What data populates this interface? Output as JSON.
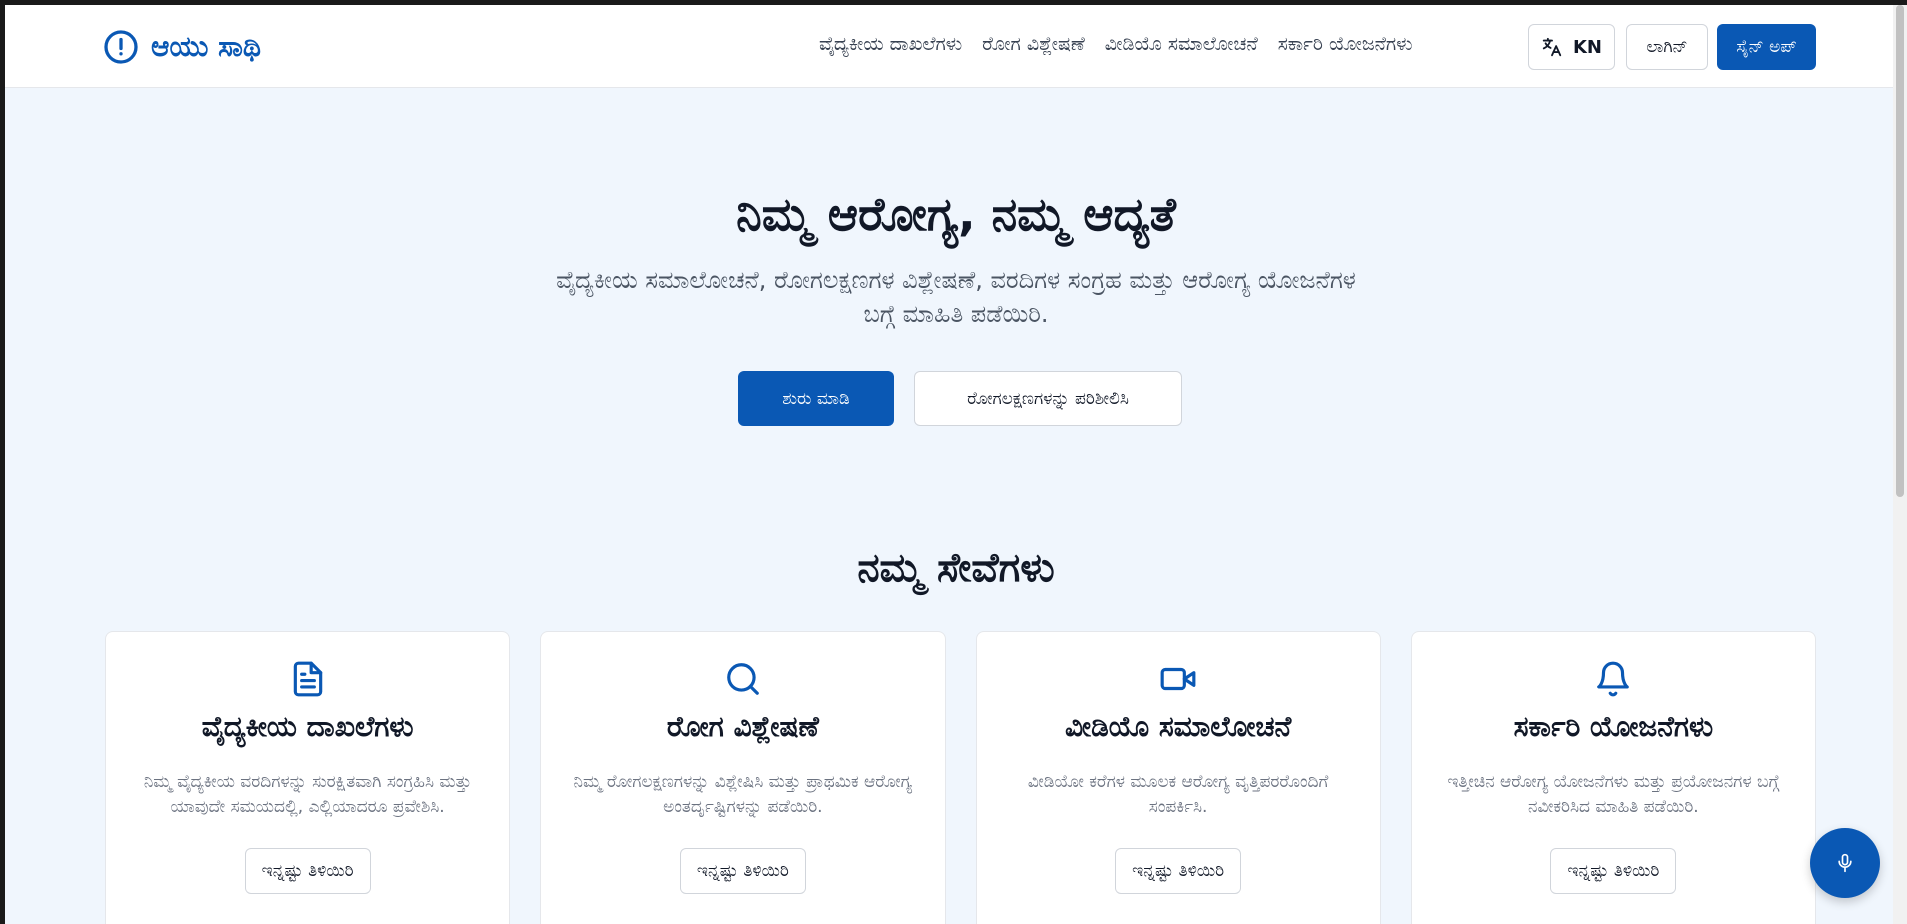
{
  "brand": {
    "name": "ಆಯು ಸಾಥಿ",
    "icon": "alert-circle-icon",
    "color": "#0a58b4"
  },
  "nav": {
    "items": [
      {
        "label": "ವೈದ್ಯಕೀಯ ದಾಖಲೆಗಳು"
      },
      {
        "label": "ರೋಗ ವಿಶ್ಲೇಷಣೆ"
      },
      {
        "label": "ವೀಡಿಯೊ ಸಮಾಲೋಚನೆ"
      },
      {
        "label": "ಸರ್ಕಾರಿ ಯೋಜನೆಗಳು"
      }
    ],
    "language_label": "KN",
    "language_icon": "translate-icon",
    "login_label": "ಲಾಗಿನ್",
    "signup_label": "ಸೈನ್ ಅಪ್"
  },
  "hero": {
    "title": "ನಿಮ್ಮ ಆರೋಗ್ಯ, ನಮ್ಮ ಆದ್ಯತೆ",
    "subtitle": "ವೈದ್ಯಕೀಯ ಸಮಾಲೋಚನೆ, ರೋಗಲಕ್ಷಣಗಳ ವಿಶ್ಲೇಷಣೆ, ವರದಿಗಳ ಸಂಗ್ರಹ ಮತ್ತು ಆರೋಗ್ಯ ಯೋಜನೆಗಳ ಬಗ್ಗೆ ಮಾಹಿತಿ ಪಡೆಯಿರಿ.",
    "primary_cta": "ಶುರು ಮಾಡಿ",
    "secondary_cta": "ರೋಗಲಕ್ಷಣಗಳನ್ನು ಪರಿಶೀಲಿಸಿ"
  },
  "services": {
    "title": "ನಮ್ಮ ಸೇವೆಗಳು",
    "cards": [
      {
        "icon": "document-icon",
        "title": "ವೈದ್ಯಕೀಯ ದಾಖಲೆಗಳು",
        "description": "ನಿಮ್ಮ ವೈದ್ಯಕೀಯ ವರದಿಗಳನ್ನು ಸುರಕ್ಷಿತವಾಗಿ ಸಂಗ್ರಹಿಸಿ ಮತ್ತು ಯಾವುದೇ ಸಮಯದಲ್ಲಿ, ಎಲ್ಲಿಯಾದರೂ ಪ್ರವೇಶಿಸಿ.",
        "button": "ಇನ್ನಷ್ಟು ತಿಳಿಯಿರಿ"
      },
      {
        "icon": "search-icon",
        "title": "ರೋಗ ವಿಶ್ಲೇಷಣೆ",
        "description": "ನಿಮ್ಮ ರೋಗಲಕ್ಷಣಗಳನ್ನು ವಿಶ್ಲೇಷಿಸಿ ಮತ್ತು ಪ್ರಾಥಮಿಕ ಆರೋಗ್ಯ ಅಂತರ್ದೃಷ್ಟಿಗಳನ್ನು ಪಡೆಯಿರಿ.",
        "button": "ಇನ್ನಷ್ಟು ತಿಳಿಯಿರಿ"
      },
      {
        "icon": "video-camera-icon",
        "title": "ವೀಡಿಯೊ ಸಮಾಲೋಚನೆ",
        "description": "ವೀಡಿಯೋ ಕರೆಗಳ ಮೂಲಕ ಆರೋಗ್ಯ ವೃತ್ತಿಪರರೊಂದಿಗೆ ಸಂಪರ್ಕಿಸಿ.",
        "button": "ಇನ್ನಷ್ಟು ತಿಳಿಯಿರಿ"
      },
      {
        "icon": "bell-icon",
        "title": "ಸರ್ಕಾರಿ ಯೋಜನೆಗಳು",
        "description": "ಇತ್ತೀಚಿನ ಆರೋಗ್ಯ ಯೋಜನೆಗಳು ಮತ್ತು ಪ್ರಯೋಜನಗಳ ಬಗ್ಗೆ ನವೀಕರಿಸಿದ ಮಾಹಿತಿ ಪಡೆಯಿರಿ.",
        "button": "ಇನ್ನಷ್ಟು ತಿಳಿಯಿರಿ"
      }
    ]
  },
  "voice_button": {
    "icon": "microphone-icon"
  },
  "colors": {
    "accent": "#0a58b4",
    "background": "#f0f6fd",
    "text": "#111827",
    "muted": "#6b7280"
  }
}
